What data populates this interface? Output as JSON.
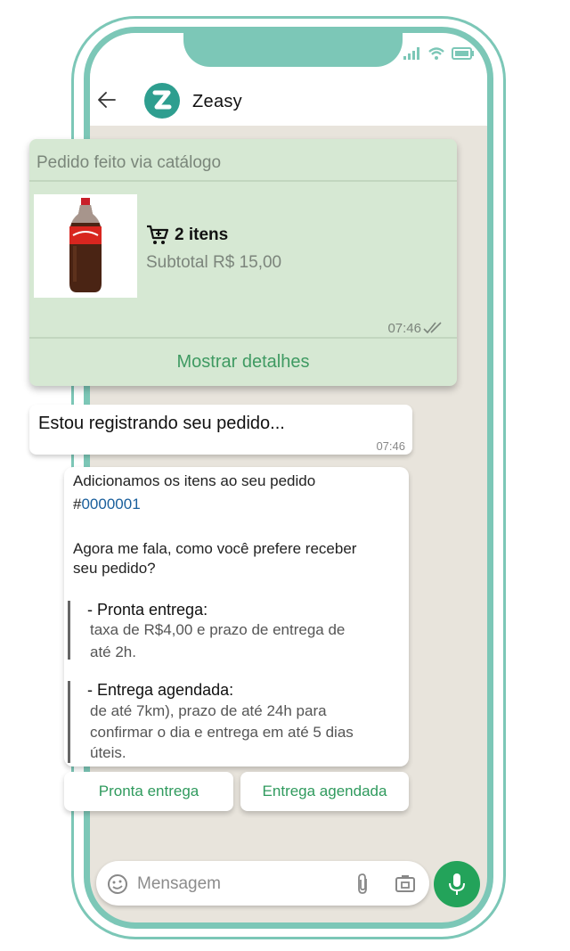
{
  "header": {
    "contact_name": "Zeasy"
  },
  "catalog_card": {
    "title": "Pedido feito via catálogo",
    "items_count": "2 itens",
    "subtotal": "Subtotal R$ 15,00",
    "time": "07:46",
    "show_details_label": "Mostrar detalhes"
  },
  "message1": {
    "text": "Estou registrando seu pedido...",
    "time": "07:46"
  },
  "message2": {
    "line1": "Adicionamos os itens ao seu pedido",
    "order_hash": "#",
    "order_number": "0000001",
    "question_line1": "Agora me fala, como você prefere receber",
    "question_line2": "seu pedido?",
    "option1_title": "- Pronta entrega:",
    "option1_desc_line1": "taxa de R$4,00 e prazo de entrega de",
    "option1_desc_line2": "até 2h.",
    "option2_title": "- Entrega agendada:",
    "option2_desc_line1": "de até 7km), prazo de até 24h para",
    "option2_desc_line2": "confirmar o dia e entrega em até 5 dias",
    "option2_desc_line3": "úteis."
  },
  "quick_replies": [
    "Pronta entrega",
    "Entrega agendada"
  ],
  "composer": {
    "placeholder": "Mensagem"
  },
  "colors": {
    "frame": "#7cc7b7",
    "accent_green": "#23a35a",
    "card_bg": "#d6e8d3",
    "chat_bg": "#e8e4dc"
  },
  "icons": [
    "back-arrow-icon",
    "zeasy-logo-icon",
    "cart-icon",
    "double-check-icon",
    "emoji-icon",
    "attach-icon",
    "camera-icon",
    "mic-icon",
    "signal-icon",
    "wifi-icon",
    "battery-icon"
  ]
}
